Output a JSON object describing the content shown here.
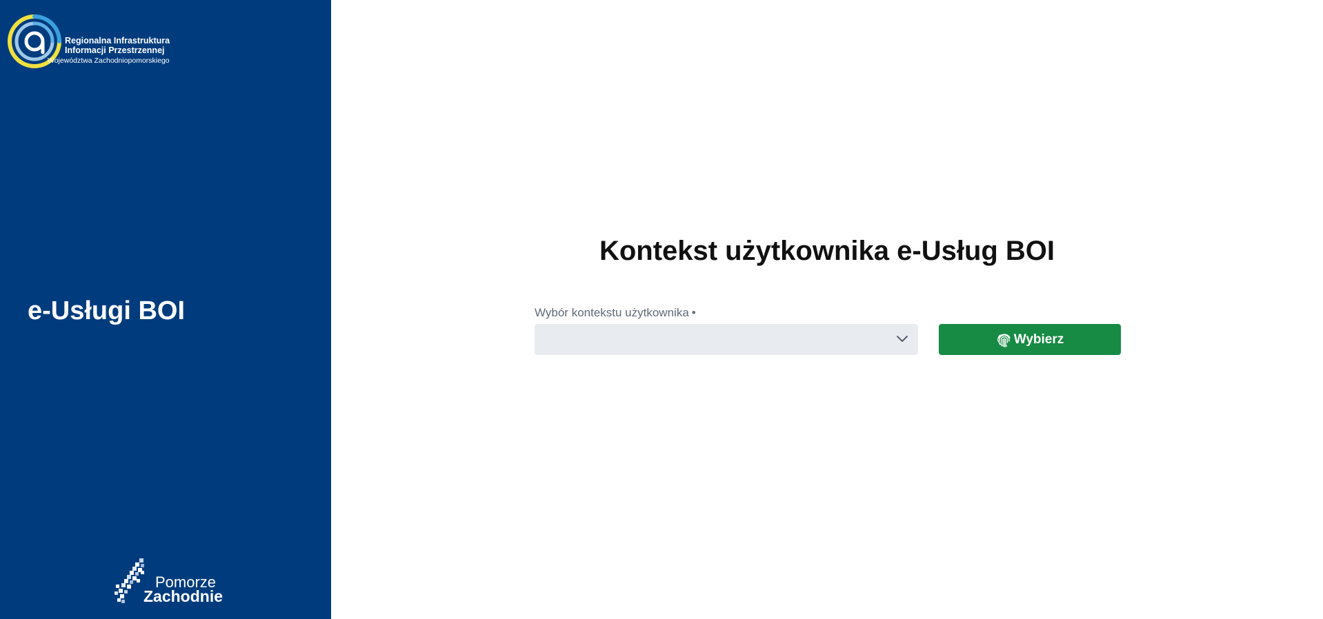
{
  "sidebar": {
    "logo": {
      "line1": "Regionalna Infrastruktura",
      "line2": "Informacji Przestrzennej",
      "line3": "Województwa Zachodniopomorskiego",
      "icon": "riip-logo-icon"
    },
    "title": "e-Usługi BOI",
    "footer_logo": {
      "line1": "Pomorze",
      "line2": "Zachodnie",
      "icon": "pomorze-zachodnie-logo-icon"
    }
  },
  "main": {
    "title": "Kontekst użytkownika e-Usług BOI",
    "context_select": {
      "label": "Wybór kontekstu użytkownika",
      "required_marker": "•",
      "value": ""
    },
    "submit_button": {
      "label": "Wybierz",
      "icon": "fingerprint-icon"
    }
  },
  "colors": {
    "sidebar_bg": "#003c7d",
    "button_bg": "#178a43",
    "select_bg": "#e8ebef",
    "logo_yellow": "#f0e040",
    "logo_blue": "#3aa0e0"
  }
}
